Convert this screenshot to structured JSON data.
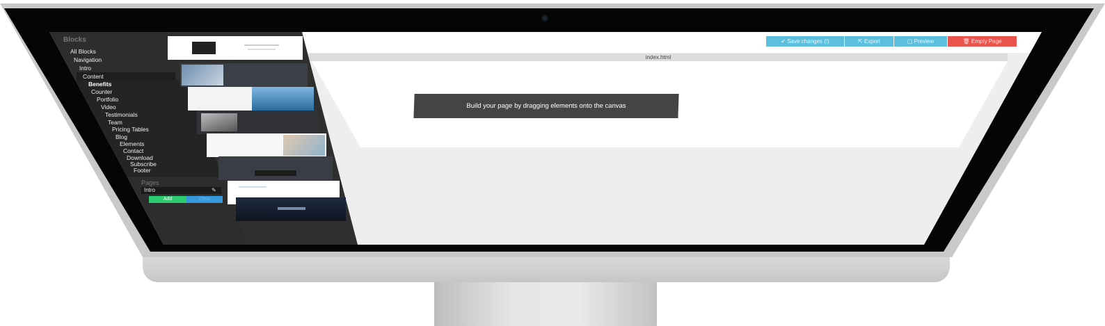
{
  "sidebar": {
    "title": "Blocks",
    "items": [
      {
        "label": "All Blocks"
      },
      {
        "label": "Navigation"
      },
      {
        "label": "Intro"
      },
      {
        "label": "Content"
      },
      {
        "label": "Benefits"
      },
      {
        "label": "Counter"
      },
      {
        "label": "Portfolio"
      },
      {
        "label": "Video"
      },
      {
        "label": "Testimonials"
      },
      {
        "label": "Team"
      },
      {
        "label": "Pricing Tables"
      },
      {
        "label": "Blog"
      },
      {
        "label": "Elements"
      },
      {
        "label": "Contact"
      },
      {
        "label": "Download"
      },
      {
        "label": "Subscribe"
      },
      {
        "label": "Footer"
      }
    ],
    "pages_title": "Pages",
    "page_item": "Intro",
    "add_label": "Add",
    "clear_label": "Clear"
  },
  "toolbar": {
    "save_label": "Save changes (!)",
    "export_label": "Export",
    "preview_label": "Preview",
    "empty_label": "Empty Page"
  },
  "canvas": {
    "tab_label": "index.html",
    "empty_message": "Build your page by dragging elements onto the canvas"
  },
  "colors": {
    "accent_blue": "#5bc0de",
    "danger_red": "#e9554c",
    "add_green": "#2ecc71",
    "clear_blue": "#3498db"
  },
  "icons": {
    "save": "check-icon",
    "export": "export-icon",
    "preview": "preview-icon",
    "empty": "trash-icon",
    "page_edit": "edit-icon"
  }
}
